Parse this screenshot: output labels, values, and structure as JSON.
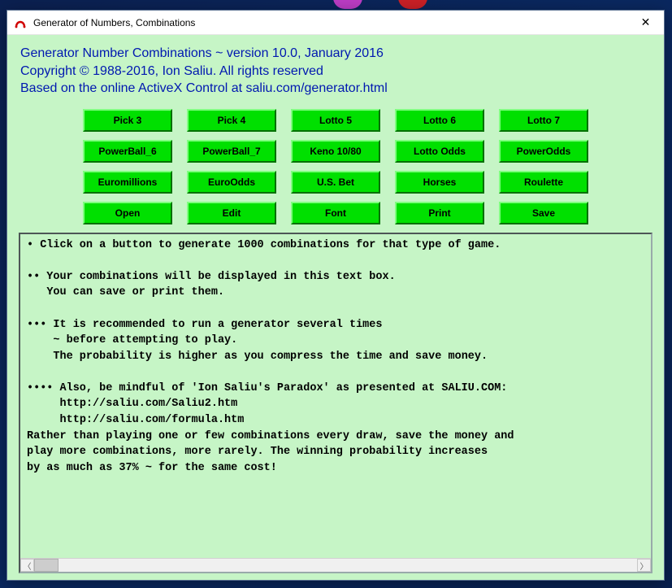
{
  "window": {
    "title": "Generator of Numbers, Combinations"
  },
  "header": {
    "line1": "Generator Number Combinations ~ version 10.0, January 2016",
    "line2": "Copyright © 1988-2016, Ion Saliu. All rights reserved",
    "line3": "Based on the online ActiveX Control at saliu.com/generator.html"
  },
  "buttons": {
    "r0c0": "Pick 3",
    "r0c1": "Pick 4",
    "r0c2": "Lotto 5",
    "r0c3": "Lotto 6",
    "r0c4": "Lotto 7",
    "r1c0": "PowerBall_6",
    "r1c1": "PowerBall_7",
    "r1c2": "Keno 10/80",
    "r1c3": "Lotto Odds",
    "r1c4": "PowerOdds",
    "r2c0": "Euromillions",
    "r2c1": "EuroOdds",
    "r2c2": "U.S. Bet",
    "r2c3": "Horses",
    "r2c4": "Roulette",
    "r3c0": "Open",
    "r3c1": "Edit",
    "r3c2": "Font",
    "r3c3": "Print",
    "r3c4": "Save"
  },
  "textbox": {
    "content": "• Click on a button to generate 1000 combinations for that type of game.\n\n•• Your combinations will be displayed in this text box.\n   You can save or print them.\n\n••• It is recommended to run a generator several times\n    ~ before attempting to play.\n    The probability is higher as you compress the time and save money.\n\n•••• Also, be mindful of 'Ion Saliu's Paradox' as presented at SALIU.COM:\n     http://saliu.com/Saliu2.htm\n     http://saliu.com/formula.htm\nRather than playing one or few combinations every draw, save the money and\nplay more combinations, more rarely. The winning probability increases\nby as much as 37% ~ for the same cost!"
  },
  "colors": {
    "client_bg": "#c6f5c6",
    "button_bg": "#00e000",
    "header_text": "#0018b0"
  }
}
